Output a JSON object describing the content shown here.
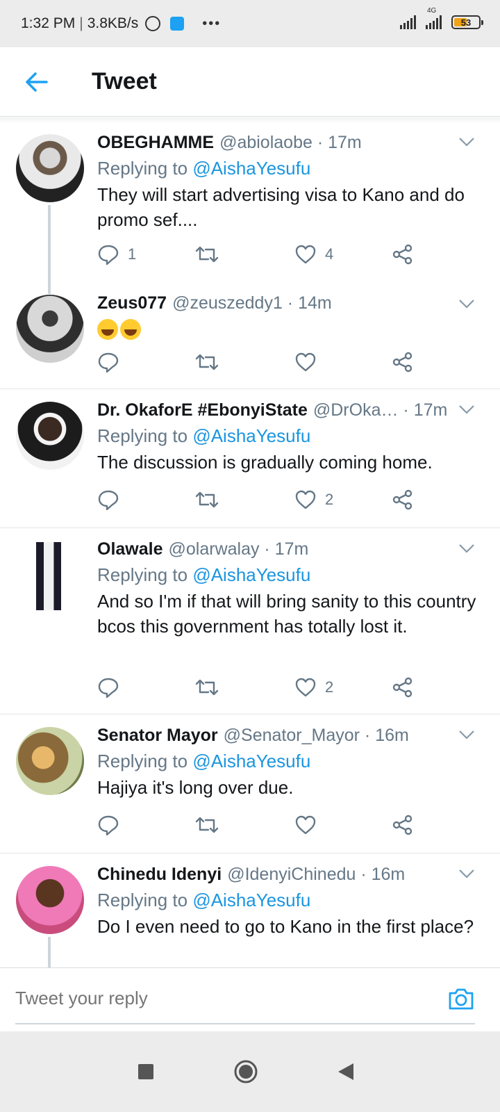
{
  "status_bar": {
    "time": "1:32 PM",
    "speed": "3.8KB/s",
    "network": "4G",
    "battery": "53",
    "battery_fraction": 0.53
  },
  "header": {
    "title": "Tweet",
    "back_icon": "arrow-left-icon"
  },
  "tweets": [
    {
      "name": "OBEGHAMME",
      "handle": "@abiolaobe · 17m",
      "replying_prefix": "Replying to",
      "replying_to": "@AishaYesufu",
      "text": "They will start advertising visa to Kano and do promo sef....",
      "replies": "1",
      "retweets": "",
      "likes": "4"
    },
    {
      "name": "Zeus077",
      "handle": "@zeuszeddy1 · 14m",
      "emojis": [
        "grinning-squinting-face",
        "grinning-squinting-face"
      ],
      "replies": "",
      "retweets": "",
      "likes": ""
    },
    {
      "name": "Dr. OkaforE #EbonyiState",
      "handle": "@DrOka… · 17m",
      "replying_prefix": "Replying to",
      "replying_to": "@AishaYesufu",
      "text": "The discussion is gradually coming home.",
      "replies": "",
      "retweets": "",
      "likes": "2"
    },
    {
      "name": "Olawale",
      "handle": "@olarwalay · 17m",
      "replying_prefix": "Replying to",
      "replying_to": "@AishaYesufu",
      "text": "And so I'm if that will bring sanity to this country bcos this government has totally lost it.",
      "replies": "",
      "retweets": "",
      "likes": "2"
    },
    {
      "name": "Senator Mayor",
      "handle": "@Senator_Mayor · 16m",
      "replying_prefix": "Replying to",
      "replying_to": "@AishaYesufu",
      "text": "Hajiya it's long over due.",
      "replies": "",
      "retweets": "",
      "likes": ""
    },
    {
      "name": "Chinedu Idenyi",
      "handle": "@IdenyiChinedu · 16m",
      "replying_prefix": "Replying to",
      "replying_to": "@AishaYesufu",
      "text": "Do I even need to go to Kano in the first place?"
    }
  ],
  "composer": {
    "placeholder": "Tweet your reply"
  },
  "colors": {
    "accent": "#1da1f2",
    "mention": "#1b95e0",
    "secondary_text": "#657786",
    "primary_text": "#14171a"
  }
}
